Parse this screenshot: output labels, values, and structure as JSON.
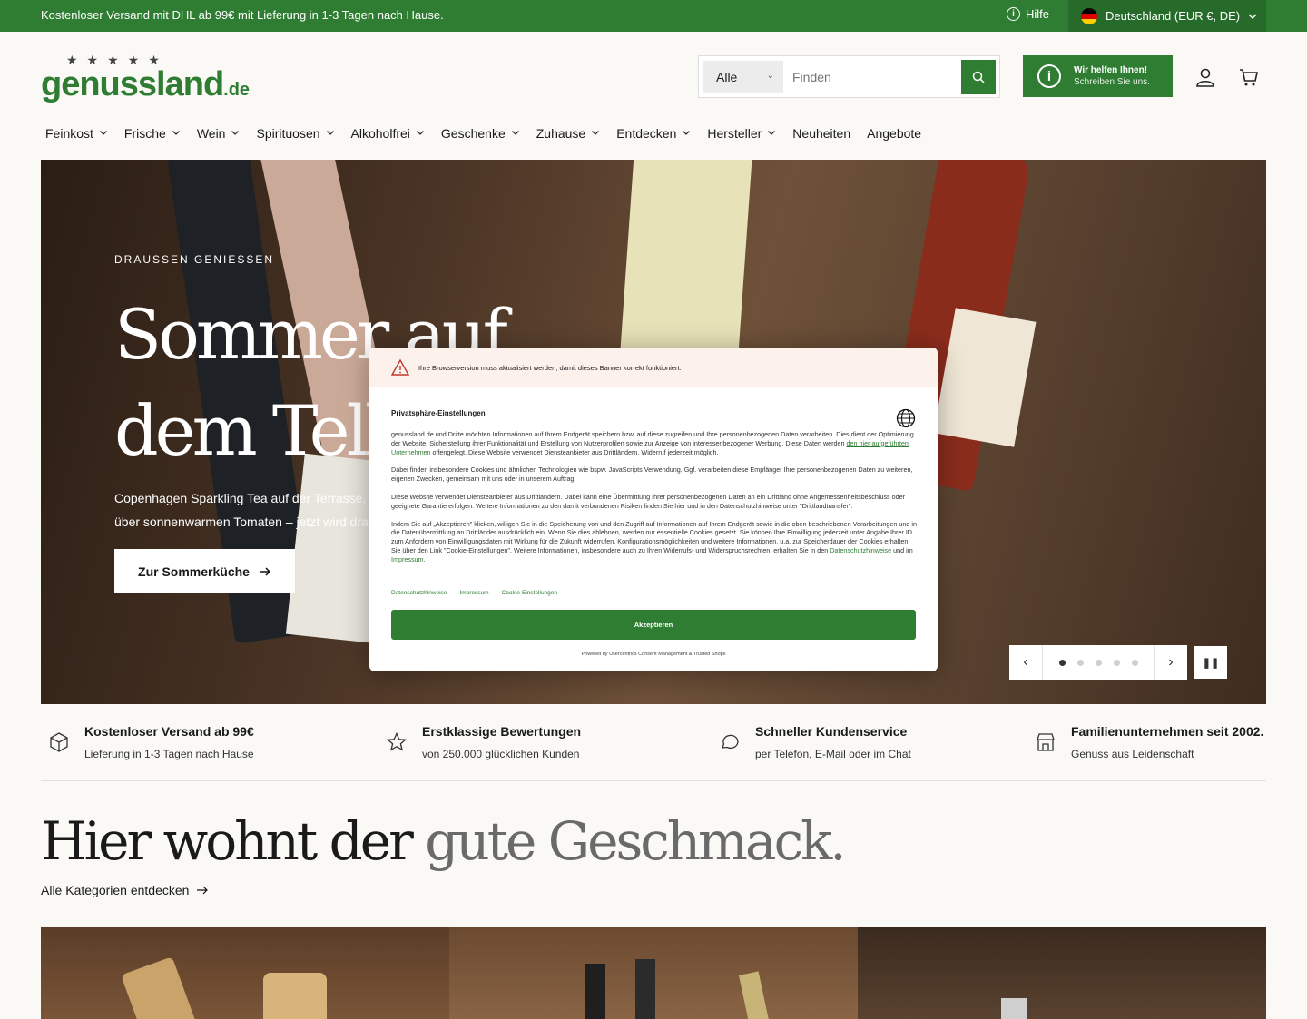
{
  "topbar": {
    "shipping_text": "Kostenloser Versand mit DHL ab 99€ mit Lieferung in 1-3 Tagen nach Hause.",
    "help_label": "Hilfe",
    "country_label": "Deutschland (EUR €, DE)"
  },
  "header": {
    "logo_text": "genussland",
    "logo_tld": ".de",
    "search": {
      "category_value": "Alle",
      "placeholder": "Finden"
    },
    "help_box": {
      "title": "Wir helfen Ihnen!",
      "subtitle": "Schreiben Sie uns."
    }
  },
  "nav": {
    "items": [
      {
        "label": "Feinkost",
        "has_dropdown": true
      },
      {
        "label": "Frische",
        "has_dropdown": true
      },
      {
        "label": "Wein",
        "has_dropdown": true
      },
      {
        "label": "Spirituosen",
        "has_dropdown": true
      },
      {
        "label": "Alkoholfrei",
        "has_dropdown": true
      },
      {
        "label": "Geschenke",
        "has_dropdown": true
      },
      {
        "label": "Zuhause",
        "has_dropdown": true
      },
      {
        "label": "Entdecken",
        "has_dropdown": true
      },
      {
        "label": "Hersteller",
        "has_dropdown": true
      },
      {
        "label": "Neuheiten",
        "has_dropdown": false
      },
      {
        "label": "Angebote",
        "has_dropdown": false
      }
    ]
  },
  "hero": {
    "eyebrow": "DRAUSSEN GENIESSEN",
    "title_line1": "Sommer auf",
    "title_line2": "dem Teller",
    "desc_line1": "Copenhagen Sparkling Tea auf der Terrasse,",
    "desc_line2": "über sonnenwarmen Tomaten – jetzt wird draußen",
    "cta_label": "Zur Sommerküche",
    "slides_count": 5,
    "active_slide": 1
  },
  "features": [
    {
      "title": "Kostenloser Versand ab 99€",
      "subtitle": "Lieferung in 1-3 Tagen nach Hause",
      "icon": "box-icon"
    },
    {
      "title": "Erstklassige Bewertungen",
      "subtitle": "von 250.000 glücklichen Kunden",
      "icon": "star-icon"
    },
    {
      "title": "Schneller Kundenservice",
      "subtitle": "per Telefon, E-Mail oder im Chat",
      "icon": "chat-icon"
    },
    {
      "title": "Familienunternehmen seit 2002.",
      "subtitle": "Genuss aus Leidenschaft",
      "icon": "store-icon"
    }
  ],
  "section": {
    "headline_part1": "Hier wohnt der ",
    "headline_part2": "gute Geschmack.",
    "link_label": "Alle Kategorien entdecken"
  },
  "cookie_modal": {
    "warning": "Ihre Browserversion muss aktualisiert werden, damit dieses Banner korrekt funktioniert.",
    "title": "Privatsphäre-Einstellungen",
    "p1_a": "genussland.de und Dritte möchten Informationen auf Ihrem Endgerät speichern bzw. auf diese zugreifen und Ihre personenbezogenen Daten verarbeiten. Dies dient der Optimierung der Website, Sicherstellung ihrer Funktionalität und Erstellung von Nutzerprofilen sowie zur Anzeige von interessenbezogener Werbung. Diese Daten werden ",
    "p1_link": "den hier aufgeführten Unternehmen",
    "p1_b": " offengelegt. Diese Website verwendet Diensteanbieter aus Drittländern. Widerruf jederzeit möglich.",
    "p2": "Dabei finden insbesondere Cookies und ähnlichen Technologien wie bspw. JavaScripts Verwendung. Ggf. verarbeiten diese Empfänger Ihre personenbezogenen Daten zu weiteren, eigenen Zwecken, gemeinsam mit uns oder in unserem Auftrag.",
    "p3": "Diese Website verwendet Diensteanbieter aus Drittländern. Dabei kann eine Übermittlung Ihrer personenbezogenen Daten an ein Drittland ohne Angemessenheitsbeschluss oder geeignete Garantie erfolgen. Weitere Informationen zu den damit verbundenen Risiken finden Sie hier und in den Datenschutzhinweise unter \"Drittlandtransfer\".",
    "p4_a": "Indem Sie auf „Akzeptieren\" klicken, willigen Sie in die Speicherung von und den Zugriff auf Informationen auf Ihrem Endgerät sowie in die oben beschriebenen Verarbeitungen und in die Datenübermittlung an Drittländer ausdrücklich ein. Wenn Sie dies ablehnen, werden nur essentielle Cookies gesetzt. Sie können Ihre Einwilligung jederzeit unter Angabe Ihrer ID zum Anfordern von Einwilligungsdaten mit Wirkung für die Zukunft widerrufen. Konfigurationsmöglichkeiten und weitere Informationen, u.a. zur Speicherdauer der Cookies erhalten Sie über den Link \"Cookie-Einstellungen\". Weitere Informationen, insbesondere auch zu Ihren Widerrufs- und Widerspruchsrechten, erhalten Sie in den ",
    "p4_link1": "Datenschutzhinweise",
    "p4_mid": " und im ",
    "p4_link2": "Impressum",
    "p4_end": ".",
    "links": [
      "Datenschutzhinweise",
      "Impressum",
      "Cookie-Einstellungen"
    ],
    "accept_label": "Akzeptieren",
    "powered_by": "Powered by Usercentrics Consent Management & Trusted Shops"
  },
  "colors": {
    "brand_green": "#2e7d32",
    "page_bg": "#faf9f5"
  }
}
